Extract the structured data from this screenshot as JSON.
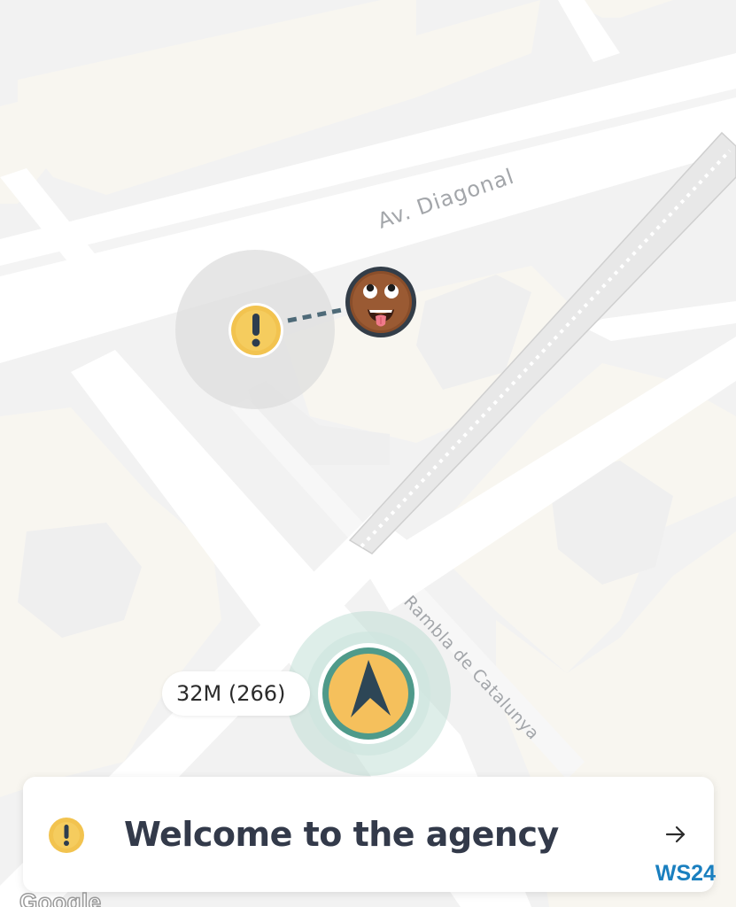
{
  "map": {
    "streets": [
      {
        "name": "Av. Diagonal"
      },
      {
        "name": "Rambla de Catalunya"
      }
    ],
    "attribution": "Google",
    "colors": {
      "background": "#f2f2f2",
      "building": "#f8f6f0",
      "road": "#ffffff",
      "railway": "#e2e2e2"
    }
  },
  "markers": {
    "alert": {
      "icon": "exclamation-icon",
      "color": "#f2c34f",
      "range_color": "#e0e0e0"
    },
    "player": {
      "icon": "tongue-out-face-avatar"
    },
    "navigation": {
      "icon": "navigation-arrow-icon",
      "color": "#f5c05c",
      "ring_color": "#4f9a8a"
    }
  },
  "distance": {
    "label": "32M (266)"
  },
  "message_card": {
    "icon": "exclamation-icon",
    "text": "Welcome to the agency",
    "action_icon": "arrow-right-icon",
    "badge": "WS24"
  }
}
